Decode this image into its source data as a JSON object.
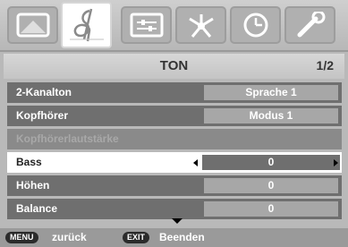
{
  "iconbar": {
    "tabs": [
      {
        "icon": "picture-icon",
        "active": false
      },
      {
        "icon": "sound-clef-icon",
        "active": true
      },
      {
        "icon": "setup-panel-icon",
        "active": false
      },
      {
        "icon": "connection-icon",
        "active": false
      },
      {
        "icon": "clock-icon",
        "active": false
      },
      {
        "icon": "wrench-icon",
        "active": false
      }
    ]
  },
  "header": {
    "title": "TON",
    "page": "1/2"
  },
  "menu": {
    "items": [
      {
        "label": "2-Kanalton",
        "value": "Sprache 1",
        "state": "normal"
      },
      {
        "label": "Kopfhörer",
        "value": "Modus 1",
        "state": "normal"
      },
      {
        "label": "Kopfhörerlautstärke",
        "value": "",
        "state": "disabled"
      },
      {
        "label": "Bass",
        "value": "0",
        "state": "selected"
      },
      {
        "label": "Höhen",
        "value": "0",
        "state": "normal"
      },
      {
        "label": "Balance",
        "value": "0",
        "state": "normal"
      }
    ]
  },
  "footer": {
    "menu_key": "MENU",
    "menu_label": "zurück",
    "exit_key": "EXIT",
    "exit_label": "Beenden"
  }
}
